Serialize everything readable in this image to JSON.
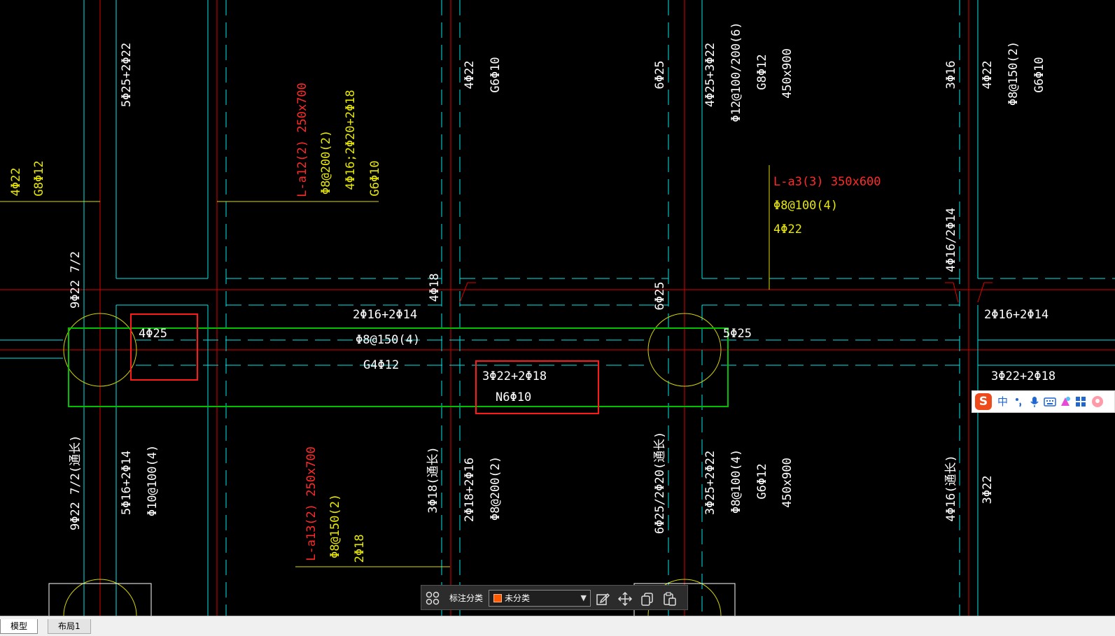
{
  "colors": {
    "background": "#000000",
    "axis_red": "#e00000",
    "beam_cyan": "#00ffff",
    "label_yellow": "#ffff00",
    "label_red": "#ff2a2a",
    "label_white": "#ffffff",
    "selection_green": "#00c000",
    "highlight_red": "#ff1a1a",
    "column_yellow": "#d4d400"
  },
  "drawing": {
    "vertical_labels": [
      {
        "id": "v1",
        "text": "5Φ25+2Φ22",
        "color": "white"
      },
      {
        "id": "v2",
        "text": "4Φ22",
        "color": "yellow"
      },
      {
        "id": "v3",
        "text": "G8Φ12",
        "color": "yellow"
      },
      {
        "id": "v4",
        "text": "L-a12(2) 250x700",
        "color": "red"
      },
      {
        "id": "v5",
        "text": "Φ8@200(2)",
        "color": "yellow"
      },
      {
        "id": "v6",
        "text": "4Φ16;2Φ20+2Φ18",
        "color": "yellow"
      },
      {
        "id": "v7",
        "text": "G6Φ10",
        "color": "yellow"
      },
      {
        "id": "v8",
        "text": "4Φ22",
        "color": "white"
      },
      {
        "id": "v9",
        "text": "G6Φ10",
        "color": "white"
      },
      {
        "id": "v10",
        "text": "6Φ25",
        "color": "white"
      },
      {
        "id": "v11",
        "text": "4Φ25+3Φ22",
        "color": "white"
      },
      {
        "id": "v12",
        "text": "Φ12@100/200(6)",
        "color": "white"
      },
      {
        "id": "v13",
        "text": "G8Φ12",
        "color": "white"
      },
      {
        "id": "v14",
        "text": "450x900",
        "color": "white"
      },
      {
        "id": "v15",
        "text": "3Φ16",
        "color": "white"
      },
      {
        "id": "v16",
        "text": "4Φ22",
        "color": "white"
      },
      {
        "id": "v17",
        "text": "Φ8@150(2)",
        "color": "white"
      },
      {
        "id": "v18",
        "text": "G6Φ10",
        "color": "white"
      },
      {
        "id": "v19",
        "text": "9Φ22 7/2",
        "color": "white"
      },
      {
        "id": "v20",
        "text": "4Φ18",
        "color": "white"
      },
      {
        "id": "v21",
        "text": "6Φ25",
        "color": "white"
      },
      {
        "id": "v22",
        "text": "4Φ16/2Φ14",
        "color": "white"
      },
      {
        "id": "v23",
        "text": "9Φ22 7/2(通长)",
        "color": "white"
      },
      {
        "id": "v24",
        "text": "5Φ16+2Φ14",
        "color": "white"
      },
      {
        "id": "v25",
        "text": "Φ10@100(4)",
        "color": "white"
      },
      {
        "id": "v26",
        "text": "L-a13(2) 250x700",
        "color": "red"
      },
      {
        "id": "v27",
        "text": "Φ8@150(2)",
        "color": "yellow"
      },
      {
        "id": "v28",
        "text": "2Φ18",
        "color": "yellow"
      },
      {
        "id": "v29",
        "text": "3Φ18(通长)",
        "color": "white"
      },
      {
        "id": "v30",
        "text": "2Φ18+2Φ16",
        "color": "white"
      },
      {
        "id": "v31",
        "text": "Φ8@200(2)",
        "color": "white"
      },
      {
        "id": "v32",
        "text": "6Φ25/2Φ20(通长)",
        "color": "white"
      },
      {
        "id": "v33",
        "text": "3Φ25+2Φ22",
        "color": "white"
      },
      {
        "id": "v34",
        "text": "Φ8@100(4)",
        "color": "white"
      },
      {
        "id": "v35",
        "text": "G6Φ12",
        "color": "white"
      },
      {
        "id": "v36",
        "text": "450x900",
        "color": "white"
      },
      {
        "id": "v37",
        "text": "4Φ16(通长)",
        "color": "white"
      },
      {
        "id": "v38",
        "text": "3Φ22",
        "color": "white"
      }
    ],
    "horizontal_labels": [
      {
        "id": "h1",
        "text": "L-a3(3) 350x600",
        "color": "red"
      },
      {
        "id": "h2",
        "text": "Φ8@100(4)",
        "color": "yellow"
      },
      {
        "id": "h3",
        "text": "4Φ22",
        "color": "yellow"
      },
      {
        "id": "h4",
        "text": "2Φ16+2Φ14",
        "color": "white"
      },
      {
        "id": "h5",
        "text": "Φ8@150(4)",
        "color": "white"
      },
      {
        "id": "h6",
        "text": "G4Φ12",
        "color": "white"
      },
      {
        "id": "h7",
        "text": "4Φ25",
        "color": "white"
      },
      {
        "id": "h8",
        "text": "3Φ22+2Φ18",
        "color": "white"
      },
      {
        "id": "h9",
        "text": "N6Φ10",
        "color": "white"
      },
      {
        "id": "h10",
        "text": "5Φ25",
        "color": "white"
      },
      {
        "id": "h11",
        "text": "2Φ16+2Φ14",
        "color": "white"
      },
      {
        "id": "h12",
        "text": "3Φ22+2Φ18",
        "color": "white"
      }
    ]
  },
  "toolbar": {
    "grid_icon": "grid-icon",
    "label": "标注分类",
    "selected_category": "未分类",
    "swatch_color": "#ff5a00",
    "buttons": [
      "edit-icon",
      "move-icon",
      "copy-icon",
      "paste-icon"
    ]
  },
  "ime": {
    "logo": "S",
    "mode": "中",
    "icons": [
      "punctuation-icon",
      "microphone-icon",
      "keyboard-icon",
      "skin-icon",
      "apps-icon",
      "avatar-icon"
    ]
  },
  "tabs": {
    "model": "模型",
    "layout": "布局1"
  }
}
